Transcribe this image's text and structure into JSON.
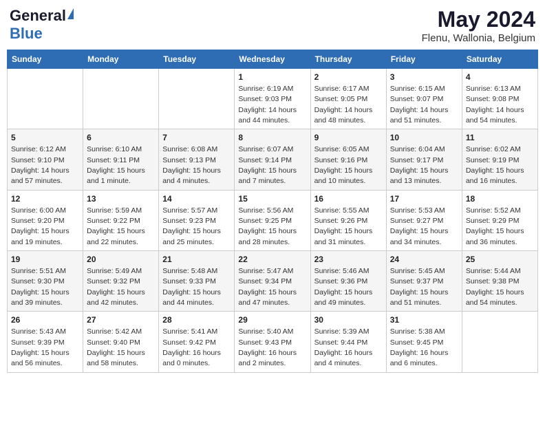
{
  "header": {
    "logo_general": "General",
    "logo_blue": "Blue",
    "month_year": "May 2024",
    "location": "Flenu, Wallonia, Belgium"
  },
  "days_of_week": [
    "Sunday",
    "Monday",
    "Tuesday",
    "Wednesday",
    "Thursday",
    "Friday",
    "Saturday"
  ],
  "weeks": [
    [
      {
        "day": "",
        "info": ""
      },
      {
        "day": "",
        "info": ""
      },
      {
        "day": "",
        "info": ""
      },
      {
        "day": "1",
        "info": "Sunrise: 6:19 AM\nSunset: 9:03 PM\nDaylight: 14 hours\nand 44 minutes."
      },
      {
        "day": "2",
        "info": "Sunrise: 6:17 AM\nSunset: 9:05 PM\nDaylight: 14 hours\nand 48 minutes."
      },
      {
        "day": "3",
        "info": "Sunrise: 6:15 AM\nSunset: 9:07 PM\nDaylight: 14 hours\nand 51 minutes."
      },
      {
        "day": "4",
        "info": "Sunrise: 6:13 AM\nSunset: 9:08 PM\nDaylight: 14 hours\nand 54 minutes."
      }
    ],
    [
      {
        "day": "5",
        "info": "Sunrise: 6:12 AM\nSunset: 9:10 PM\nDaylight: 14 hours\nand 57 minutes."
      },
      {
        "day": "6",
        "info": "Sunrise: 6:10 AM\nSunset: 9:11 PM\nDaylight: 15 hours\nand 1 minute."
      },
      {
        "day": "7",
        "info": "Sunrise: 6:08 AM\nSunset: 9:13 PM\nDaylight: 15 hours\nand 4 minutes."
      },
      {
        "day": "8",
        "info": "Sunrise: 6:07 AM\nSunset: 9:14 PM\nDaylight: 15 hours\nand 7 minutes."
      },
      {
        "day": "9",
        "info": "Sunrise: 6:05 AM\nSunset: 9:16 PM\nDaylight: 15 hours\nand 10 minutes."
      },
      {
        "day": "10",
        "info": "Sunrise: 6:04 AM\nSunset: 9:17 PM\nDaylight: 15 hours\nand 13 minutes."
      },
      {
        "day": "11",
        "info": "Sunrise: 6:02 AM\nSunset: 9:19 PM\nDaylight: 15 hours\nand 16 minutes."
      }
    ],
    [
      {
        "day": "12",
        "info": "Sunrise: 6:00 AM\nSunset: 9:20 PM\nDaylight: 15 hours\nand 19 minutes."
      },
      {
        "day": "13",
        "info": "Sunrise: 5:59 AM\nSunset: 9:22 PM\nDaylight: 15 hours\nand 22 minutes."
      },
      {
        "day": "14",
        "info": "Sunrise: 5:57 AM\nSunset: 9:23 PM\nDaylight: 15 hours\nand 25 minutes."
      },
      {
        "day": "15",
        "info": "Sunrise: 5:56 AM\nSunset: 9:25 PM\nDaylight: 15 hours\nand 28 minutes."
      },
      {
        "day": "16",
        "info": "Sunrise: 5:55 AM\nSunset: 9:26 PM\nDaylight: 15 hours\nand 31 minutes."
      },
      {
        "day": "17",
        "info": "Sunrise: 5:53 AM\nSunset: 9:27 PM\nDaylight: 15 hours\nand 34 minutes."
      },
      {
        "day": "18",
        "info": "Sunrise: 5:52 AM\nSunset: 9:29 PM\nDaylight: 15 hours\nand 36 minutes."
      }
    ],
    [
      {
        "day": "19",
        "info": "Sunrise: 5:51 AM\nSunset: 9:30 PM\nDaylight: 15 hours\nand 39 minutes."
      },
      {
        "day": "20",
        "info": "Sunrise: 5:49 AM\nSunset: 9:32 PM\nDaylight: 15 hours\nand 42 minutes."
      },
      {
        "day": "21",
        "info": "Sunrise: 5:48 AM\nSunset: 9:33 PM\nDaylight: 15 hours\nand 44 minutes."
      },
      {
        "day": "22",
        "info": "Sunrise: 5:47 AM\nSunset: 9:34 PM\nDaylight: 15 hours\nand 47 minutes."
      },
      {
        "day": "23",
        "info": "Sunrise: 5:46 AM\nSunset: 9:36 PM\nDaylight: 15 hours\nand 49 minutes."
      },
      {
        "day": "24",
        "info": "Sunrise: 5:45 AM\nSunset: 9:37 PM\nDaylight: 15 hours\nand 51 minutes."
      },
      {
        "day": "25",
        "info": "Sunrise: 5:44 AM\nSunset: 9:38 PM\nDaylight: 15 hours\nand 54 minutes."
      }
    ],
    [
      {
        "day": "26",
        "info": "Sunrise: 5:43 AM\nSunset: 9:39 PM\nDaylight: 15 hours\nand 56 minutes."
      },
      {
        "day": "27",
        "info": "Sunrise: 5:42 AM\nSunset: 9:40 PM\nDaylight: 15 hours\nand 58 minutes."
      },
      {
        "day": "28",
        "info": "Sunrise: 5:41 AM\nSunset: 9:42 PM\nDaylight: 16 hours\nand 0 minutes."
      },
      {
        "day": "29",
        "info": "Sunrise: 5:40 AM\nSunset: 9:43 PM\nDaylight: 16 hours\nand 2 minutes."
      },
      {
        "day": "30",
        "info": "Sunrise: 5:39 AM\nSunset: 9:44 PM\nDaylight: 16 hours\nand 4 minutes."
      },
      {
        "day": "31",
        "info": "Sunrise: 5:38 AM\nSunset: 9:45 PM\nDaylight: 16 hours\nand 6 minutes."
      },
      {
        "day": "",
        "info": ""
      }
    ]
  ]
}
